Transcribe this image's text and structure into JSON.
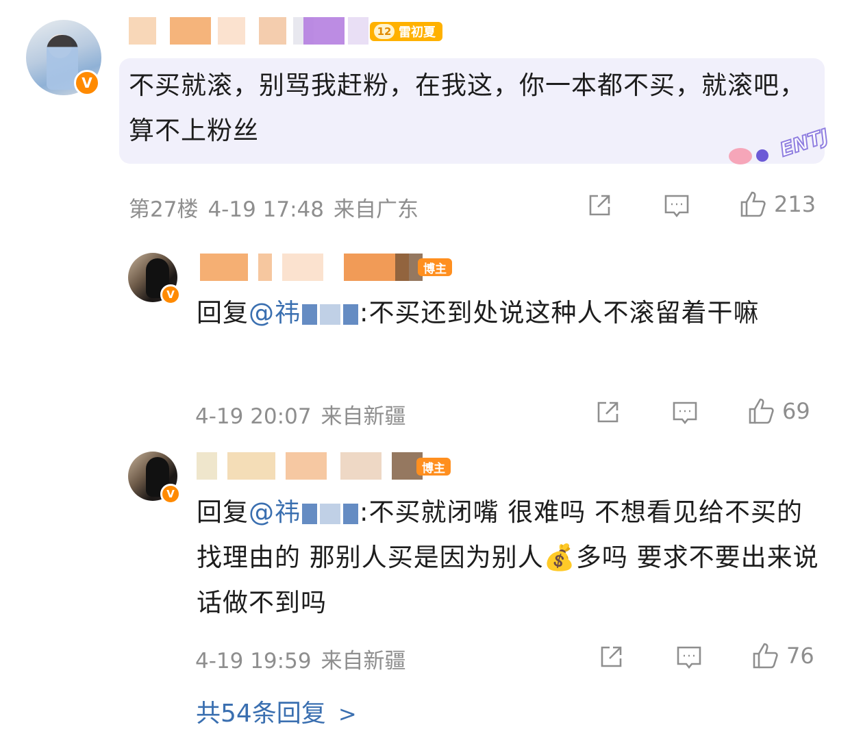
{
  "comments": [
    {
      "text": "不买就滚，别骂我赶粉，在我这，你一本都不买，就滚吧，算不上粉丝",
      "level": "12",
      "level_tag": "雷初夏",
      "floor": "第27楼",
      "time": "4-19 17:48",
      "location": "来自广东",
      "likes": "213",
      "sticker_text": "ENTJ"
    },
    {
      "reply_prefix": "回复",
      "mention_start": "@祎",
      "mention_end": "",
      "text": ":不买还到处说这种人不滚留着干嘛",
      "role_tag": "博主",
      "time": "4-19 20:07",
      "location": "来自新疆",
      "likes": "69"
    },
    {
      "reply_prefix": "回复",
      "mention_start": "@祎",
      "mention_end": "",
      "text_before_emoji": ":不买就闭嘴 很难吗 不想看见给不买的找理由的 那别人买是因为别人",
      "emoji": "💰",
      "text_after_emoji": "多吗 要求不要出来说话做不到吗",
      "role_tag": "博主",
      "time": "4-19 19:59",
      "location": "来自新疆",
      "likes": "76"
    }
  ],
  "more_replies": "共54条回复",
  "colors": {
    "accent_blue": "#3a6fb0",
    "meta_gray": "#8e8e8e",
    "bubble_bg": "#f1f0fb",
    "badge_orange": "#ff8a00"
  },
  "icons": [
    "share-icon",
    "comment-icon",
    "like-icon",
    "chevron-right-icon",
    "verified-badge-icon"
  ]
}
